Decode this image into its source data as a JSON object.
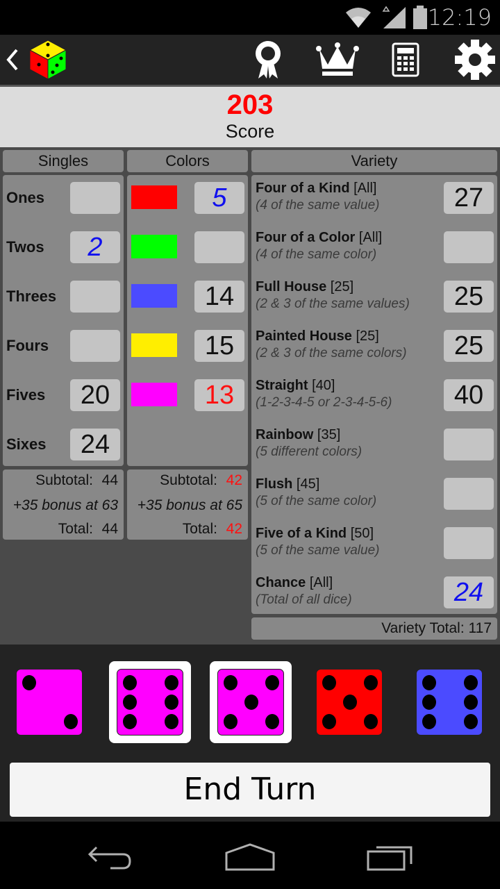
{
  "status_bar": {
    "time": "12:19",
    "icons": [
      "wifi-icon",
      "signal-icon",
      "battery-icon"
    ]
  },
  "action_bar": {
    "icons": [
      "back-icon",
      "app-logo-dice",
      "achievements-ribbon-icon",
      "leaderboard-crown-icon",
      "calculator-icon",
      "settings-gear-icon"
    ]
  },
  "score": {
    "value": "203",
    "label": "Score",
    "value_color": "#ff0000"
  },
  "headers": {
    "singles": "Singles",
    "colors": "Colors",
    "variety": "Variety"
  },
  "singles": [
    {
      "label": "Ones",
      "value": "",
      "style": ""
    },
    {
      "label": "Twos",
      "value": "2",
      "style": "blue"
    },
    {
      "label": "Threes",
      "value": "",
      "style": ""
    },
    {
      "label": "Fours",
      "value": "",
      "style": ""
    },
    {
      "label": "Fives",
      "value": "20",
      "style": ""
    },
    {
      "label": "Sixes",
      "value": "24",
      "style": ""
    }
  ],
  "colors": [
    {
      "color": "#ff0000",
      "name": "red",
      "value": "5",
      "style": "blue"
    },
    {
      "color": "#00ff00",
      "name": "green",
      "value": "",
      "style": ""
    },
    {
      "color": "#4b4bff",
      "name": "blue",
      "value": "14",
      "style": ""
    },
    {
      "color": "#ffee00",
      "name": "yellow",
      "value": "15",
      "style": ""
    },
    {
      "color": "#ff00ff",
      "name": "magenta",
      "value": "13",
      "style": "red"
    }
  ],
  "singles_totals": {
    "subtotal_label": "Subtotal:",
    "subtotal": "44",
    "bonus": "+35 bonus at 63",
    "total_label": "Total:",
    "total": "44"
  },
  "colors_totals": {
    "subtotal_label": "Subtotal:",
    "subtotal": "42",
    "bonus": "+35 bonus at 65",
    "total_label": "Total:",
    "total": "42",
    "value_color": "#ff1010"
  },
  "variety": [
    {
      "name": "Four of a Kind",
      "points": "[All]",
      "desc": "(4 of the same value)",
      "value": "27",
      "style": ""
    },
    {
      "name": "Four of a Color",
      "points": "[All]",
      "desc": "(4 of the same color)",
      "value": "",
      "style": ""
    },
    {
      "name": "Full House",
      "points": "[25]",
      "desc": "(2 & 3 of the same values)",
      "value": "25",
      "style": ""
    },
    {
      "name": "Painted House",
      "points": "[25]",
      "desc": "(2 & 3 of the same colors)",
      "value": "25",
      "style": ""
    },
    {
      "name": "Straight",
      "points": "[40]",
      "desc": "(1-2-3-4-5 or 2-3-4-5-6)",
      "value": "40",
      "style": ""
    },
    {
      "name": "Rainbow",
      "points": "[35]",
      "desc": "(5 different colors)",
      "value": "",
      "style": ""
    },
    {
      "name": "Flush",
      "points": "[45]",
      "desc": "(5 of the same color)",
      "value": "",
      "style": ""
    },
    {
      "name": "Five of a Kind",
      "points": "[50]",
      "desc": "(5 of the same value)",
      "value": "",
      "style": ""
    },
    {
      "name": "Chance",
      "points": "[All]",
      "desc": "(Total of all dice)",
      "value": "24",
      "style": "blue"
    }
  ],
  "variety_total": "Variety Total: 117",
  "dice": [
    {
      "value": 2,
      "color": "#ff00ff",
      "held": false
    },
    {
      "value": 6,
      "color": "#ff00ff",
      "held": true
    },
    {
      "value": 5,
      "color": "#ff00ff",
      "held": true
    },
    {
      "value": 5,
      "color": "#ff0000",
      "held": false
    },
    {
      "value": 6,
      "color": "#4b4bff",
      "held": false
    }
  ],
  "end_turn_label": "End Turn",
  "nav_bar": {
    "buttons": [
      "back-nav-icon",
      "home-nav-icon",
      "recents-nav-icon"
    ]
  }
}
